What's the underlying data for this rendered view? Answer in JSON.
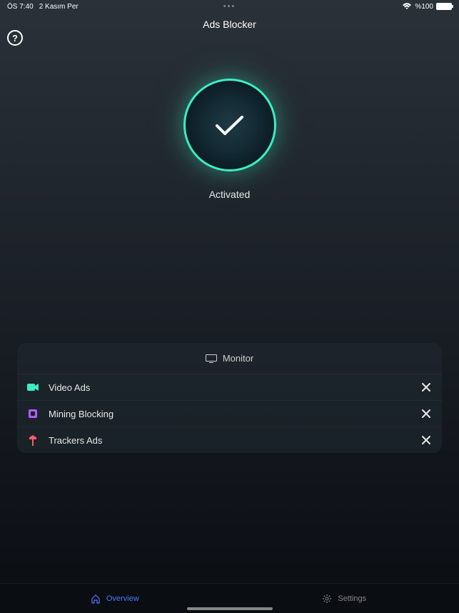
{
  "status_bar": {
    "time": "ÖS 7:40",
    "date": "2 Kasım Per",
    "battery": "%100"
  },
  "header": {
    "title": "Ads Blocker"
  },
  "help_label": "?",
  "activation": {
    "status": "Activated"
  },
  "monitor": {
    "title": "Monitor",
    "rows": [
      {
        "label": "Video Ads",
        "icon_name": "video-icon",
        "icon_color": "#3beec2"
      },
      {
        "label": "Mining Blocking",
        "icon_name": "mining-icon",
        "icon_color": "#b45aff"
      },
      {
        "label": "Trackers Ads",
        "icon_name": "trackers-icon",
        "icon_color": "#ff5a6a"
      }
    ]
  },
  "tabs": {
    "overview": "Overview",
    "settings": "Settings"
  }
}
